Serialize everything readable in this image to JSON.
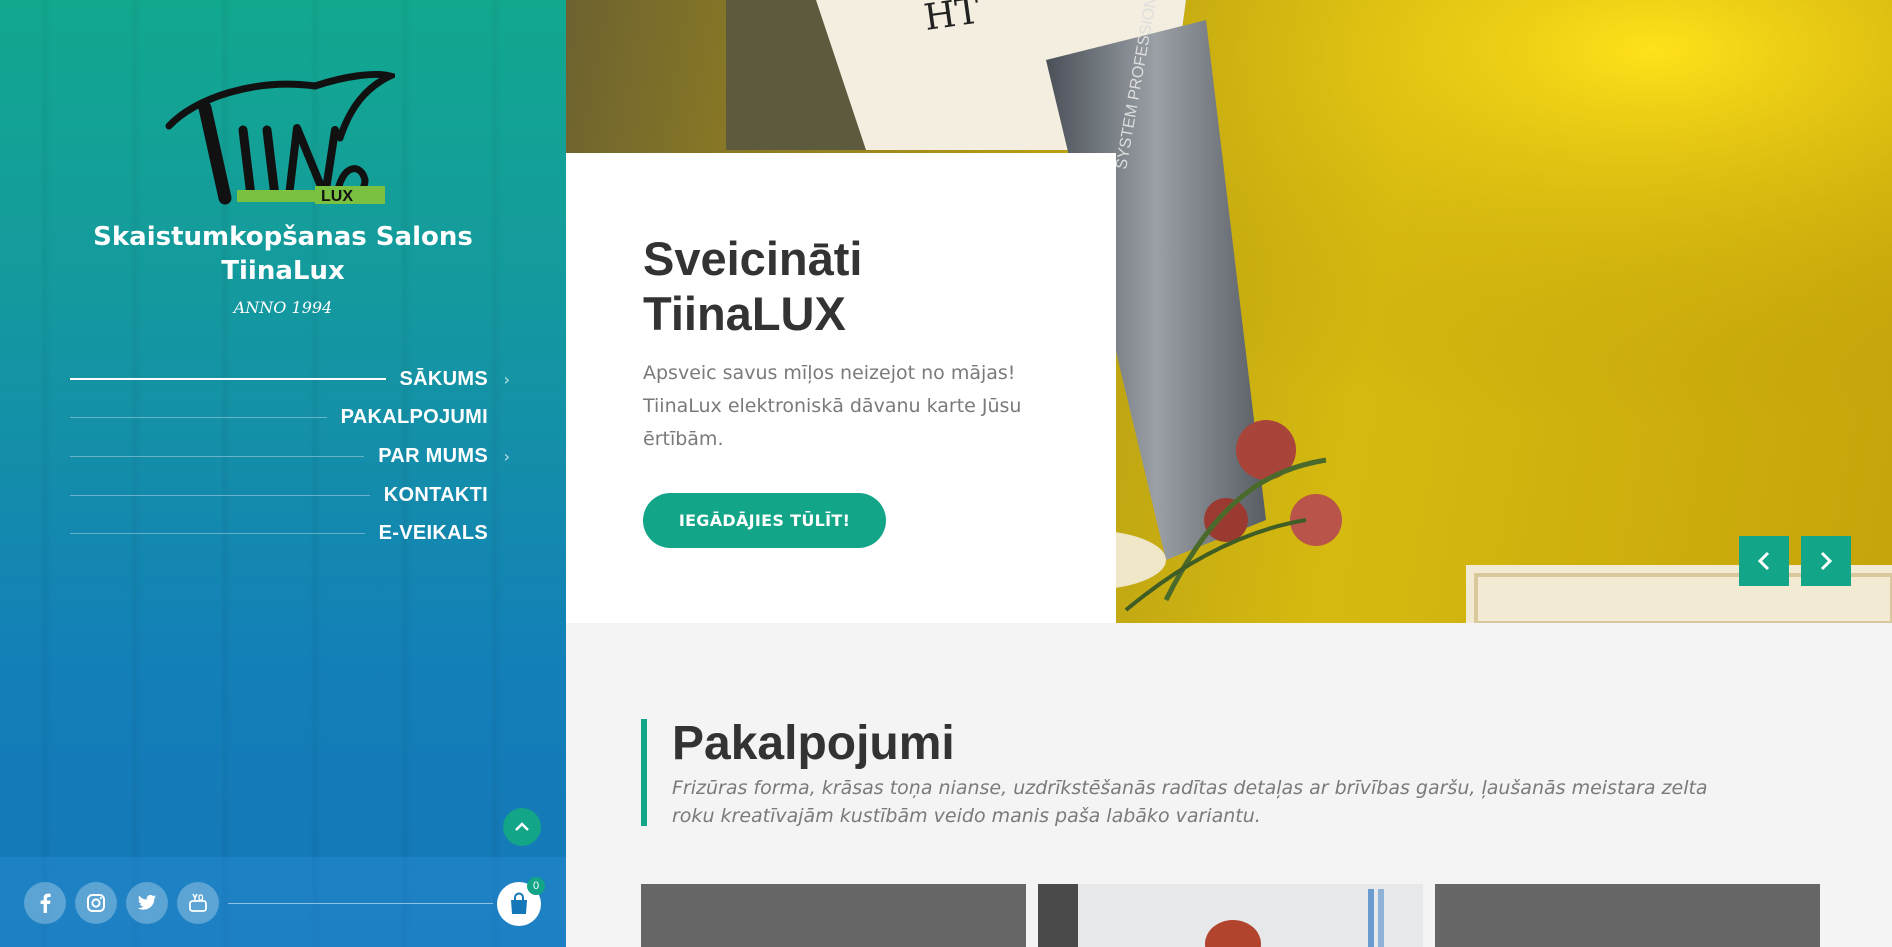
{
  "sidebar": {
    "logo": {
      "word": "TiiNa",
      "tag": "LUX"
    },
    "title_line1": "Skaistumkopšanas Salons",
    "title_line2": "TiinaLux",
    "subtitle": "ANNO 1994",
    "nav": [
      {
        "label": "SĀKUMS",
        "active": true,
        "has_submenu": true
      },
      {
        "label": "PAKALPOJUMI",
        "active": false,
        "has_submenu": false
      },
      {
        "label": "PAR MUMS",
        "active": false,
        "has_submenu": true
      },
      {
        "label": "KONTAKTI",
        "active": false,
        "has_submenu": false
      },
      {
        "label": "E-VEIKALS",
        "active": false,
        "has_submenu": false
      }
    ],
    "social": [
      "facebook-icon",
      "instagram-icon",
      "twitter-icon",
      "youtube-icon"
    ],
    "cart_count": "0"
  },
  "hero": {
    "title_line1": "Sveicināti",
    "title_line2": "TiinaLUX",
    "text": "Apsveic savus mīļos neizejot no mājas! TiinaLux elektroniskā dāvanu karte Jūsu ērtībām.",
    "button": "IEGĀDĀJIES TŪLĪT!",
    "bg_text": "SYSTEM PROFESSIONAL"
  },
  "services": {
    "title": "Pakalpojumi",
    "subtitle": "Frizūras forma, krāsas toņa nianse, uzdrīkstēšanās radītas detaļas ar brīvības garšu, ļaušanās meistara zelta roku kreatīvajām kustībām veido manis paša labāko variantu."
  },
  "colors": {
    "accent": "#12a587",
    "sidebar_top": "#12a88f",
    "sidebar_bottom": "#1477b8"
  }
}
